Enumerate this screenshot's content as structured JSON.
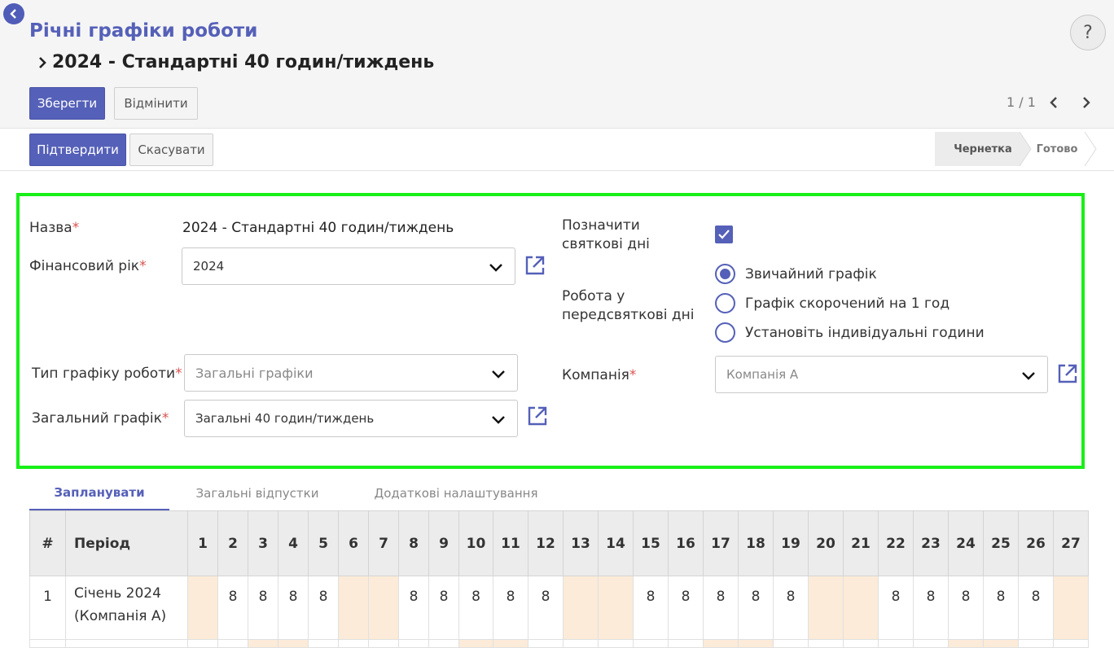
{
  "header": {
    "title": "Річні графіки роботи",
    "record_title": "2024 - Стандартні 40 годин/тиждень",
    "save_label": "Зберегти",
    "discard_label": "Відмінити",
    "pager": "1 / 1",
    "help": "?"
  },
  "status": {
    "confirm_label": "Підтвердити",
    "cancel_label": "Скасувати",
    "stages": [
      "Чернетка",
      "Готово"
    ],
    "current_stage": "Чернетка"
  },
  "form": {
    "name_label": "Назва",
    "name_value": "2024 - Стандартні 40 годин/тиждень",
    "fiscal_year_label": "Фінансовий рік",
    "fiscal_year_value": "2024",
    "schedule_type_label": "Тип графіку роботи",
    "schedule_type_placeholder": "Загальні графіки",
    "general_schedule_label": "Загальний графік",
    "general_schedule_value": "Загальні 40 годин/тиждень",
    "holidays_label_1": "Позначити",
    "holidays_label_2": "святкові дні",
    "holidays_checked": true,
    "preholiday_label_1": "Робота у",
    "preholiday_label_2": "передсвяткові дні",
    "preholiday_options": [
      "Звичайний графік",
      "Графік скорочений на 1 год",
      "Установіть індивідуальні години"
    ],
    "preholiday_selected": 0,
    "company_label": "Компанія",
    "company_value": "Компанія А",
    "required_mark": "*"
  },
  "tabs": [
    "Запланувати",
    "Загальні відпустки",
    "Додаткові налаштування"
  ],
  "active_tab": 0,
  "grid": {
    "col_num": "#",
    "col_period": "Період",
    "days": [
      "1",
      "2",
      "3",
      "4",
      "5",
      "6",
      "7",
      "8",
      "9",
      "10",
      "11",
      "12",
      "13",
      "14",
      "15",
      "16",
      "17",
      "18",
      "19",
      "20",
      "21",
      "22",
      "23",
      "24",
      "25",
      "26",
      "27"
    ],
    "rows": [
      {
        "num": "1",
        "period_1": "Січень 2024",
        "period_2": "(Компанія А)",
        "hours": [
          "",
          "8",
          "8",
          "8",
          "8",
          "",
          "",
          "8",
          "8",
          "8",
          "8",
          "8",
          "",
          "",
          "8",
          "8",
          "8",
          "8",
          "8",
          "",
          "",
          "8",
          "8",
          "8",
          "8",
          "8",
          ""
        ],
        "weekend": [
          true,
          false,
          false,
          false,
          false,
          true,
          true,
          false,
          false,
          false,
          false,
          false,
          true,
          true,
          false,
          false,
          false,
          false,
          false,
          true,
          true,
          false,
          false,
          false,
          false,
          false,
          true
        ]
      }
    ],
    "row2_weekend": [
      false,
      false,
      true,
      true,
      false,
      false,
      false,
      false,
      false,
      true,
      true,
      false,
      false,
      false,
      false,
      false,
      true,
      true,
      false,
      false,
      false,
      false,
      false,
      true,
      true,
      false,
      false
    ]
  },
  "colors": {
    "accent": "#5560b8",
    "highlight": "#18f018",
    "weekend": "#fbebd8"
  }
}
